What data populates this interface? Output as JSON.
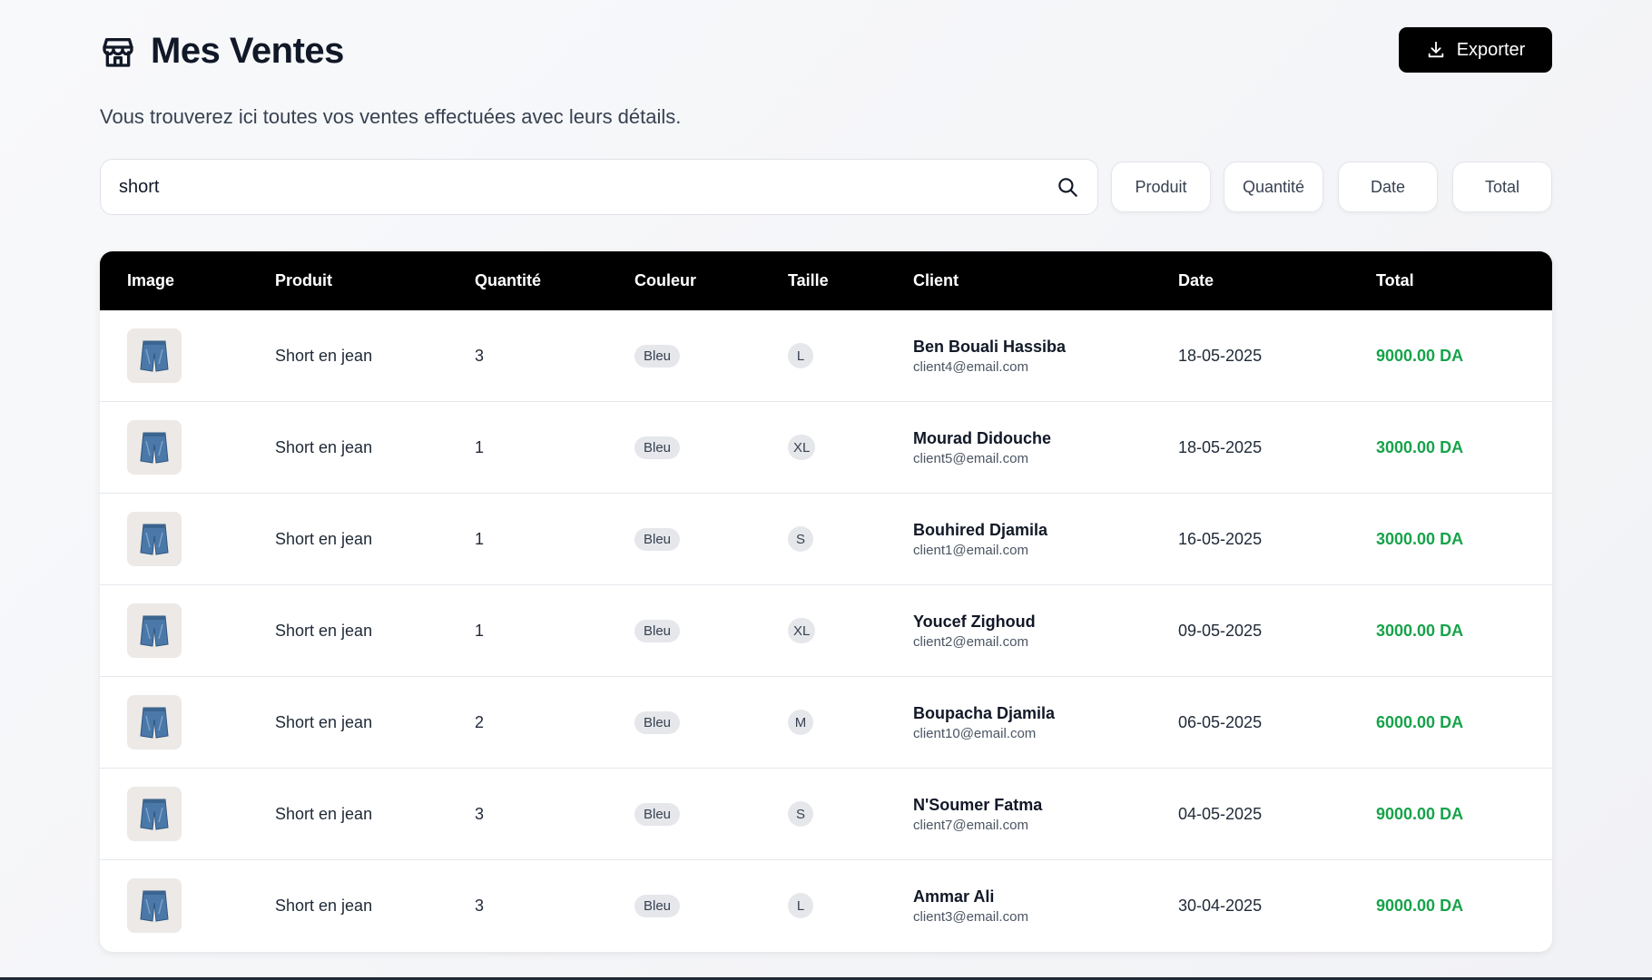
{
  "header": {
    "title": "Mes Ventes",
    "title_icon": "store-icon",
    "export_label": "Exporter",
    "export_icon": "download-icon"
  },
  "subtitle": "Vous trouverez ici toutes vos ventes effectuées avec leurs détails.",
  "search": {
    "value": "short",
    "icon": "search-icon"
  },
  "sort_buttons": [
    "Produit",
    "Quantité",
    "Date",
    "Total"
  ],
  "table": {
    "columns": [
      "Image",
      "Produit",
      "Quantité",
      "Couleur",
      "Taille",
      "Client",
      "Date",
      "Total"
    ],
    "rows": [
      {
        "produit": "Short en jean",
        "quantite": "3",
        "couleur": "Bleu",
        "taille": "L",
        "client_name": "Ben Bouali Hassiba",
        "client_email": "client4@email.com",
        "date": "18-05-2025",
        "total": "9000.00 DA"
      },
      {
        "produit": "Short en jean",
        "quantite": "1",
        "couleur": "Bleu",
        "taille": "XL",
        "client_name": "Mourad Didouche",
        "client_email": "client5@email.com",
        "date": "18-05-2025",
        "total": "3000.00 DA"
      },
      {
        "produit": "Short en jean",
        "quantite": "1",
        "couleur": "Bleu",
        "taille": "S",
        "client_name": "Bouhired Djamila",
        "client_email": "client1@email.com",
        "date": "16-05-2025",
        "total": "3000.00 DA"
      },
      {
        "produit": "Short en jean",
        "quantite": "1",
        "couleur": "Bleu",
        "taille": "XL",
        "client_name": "Youcef Zighoud",
        "client_email": "client2@email.com",
        "date": "09-05-2025",
        "total": "3000.00 DA"
      },
      {
        "produit": "Short en jean",
        "quantite": "2",
        "couleur": "Bleu",
        "taille": "M",
        "client_name": "Boupacha Djamila",
        "client_email": "client10@email.com",
        "date": "06-05-2025",
        "total": "6000.00 DA"
      },
      {
        "produit": "Short en jean",
        "quantite": "3",
        "couleur": "Bleu",
        "taille": "S",
        "client_name": "N'Soumer Fatma",
        "client_email": "client7@email.com",
        "date": "04-05-2025",
        "total": "9000.00 DA"
      },
      {
        "produit": "Short en jean",
        "quantite": "3",
        "couleur": "Bleu",
        "taille": "L",
        "client_name": "Ammar Ali",
        "client_email": "client3@email.com",
        "date": "30-04-2025",
        "total": "9000.00 DA"
      }
    ]
  },
  "colors": {
    "accent": "#000000",
    "total_green": "#16a34a",
    "pill_bg": "#e5e7eb"
  }
}
